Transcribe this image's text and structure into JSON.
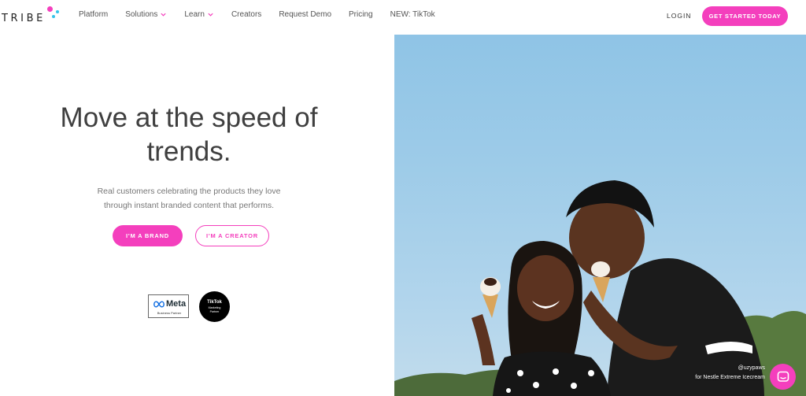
{
  "brand": {
    "logo_text": "TRIBE",
    "colors": {
      "accent": "#f43fbd",
      "dot_blue": "#35c3ea"
    }
  },
  "nav": {
    "links": [
      {
        "label": "Platform",
        "has_dropdown": false
      },
      {
        "label": "Solutions",
        "has_dropdown": true
      },
      {
        "label": "Learn",
        "has_dropdown": true
      },
      {
        "label": "Creators",
        "has_dropdown": false
      },
      {
        "label": "Request Demo",
        "has_dropdown": false
      },
      {
        "label": "Pricing",
        "has_dropdown": false
      },
      {
        "label": "NEW: TikTok",
        "has_dropdown": false
      }
    ],
    "login_label": "LOGIN",
    "cta_label": "GET STARTED TODAY"
  },
  "hero": {
    "title_line1": "Move at the speed of",
    "title_line2": "trends.",
    "subtitle_line1": "Real customers celebrating the products they love",
    "subtitle_line2": "through instant branded content that performs.",
    "brand_button": "I'M A BRAND",
    "creator_button": "I'M A CREATOR"
  },
  "badges": {
    "meta_name": "Meta",
    "meta_sub": "Business Partner",
    "tiktok_name": "TikTok",
    "tiktok_sub_line1": "Marketing",
    "tiktok_sub_line2": "Partner"
  },
  "image": {
    "credit_handle": "@uzypaws",
    "credit_brand": "for Nestle Extreme Icecream"
  },
  "icons": {
    "dropdown": "chevron-down-icon",
    "chat": "chat-icon",
    "meta": "meta-infinity-icon"
  }
}
